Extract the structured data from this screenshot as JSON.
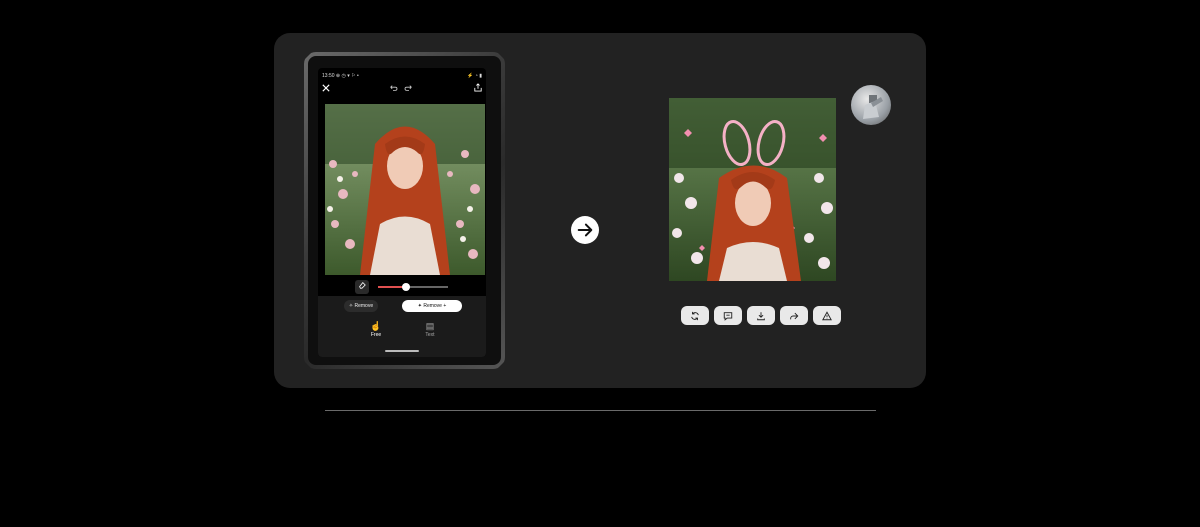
{
  "tablet": {
    "status_time": "13:50",
    "status_icons": "⊕ ◷ ▾ ⚐ •",
    "status_right": "⚡ ◔ ▮",
    "toolbar": {
      "close_icon": "close-icon",
      "undo_icon": "undo-icon",
      "redo_icon": "redo-icon",
      "share_icon": "share-icon"
    },
    "brush_size": 0.4,
    "buttons": {
      "remove_label": "Remove",
      "remove_plus_label": "Remove +"
    },
    "modes": [
      {
        "label": "Free",
        "icon": "hand-pointer-icon"
      },
      {
        "label": "Text",
        "icon": "text-doc-icon"
      }
    ]
  },
  "arrow_icon": "arrow-right-icon",
  "result": {
    "actions": [
      {
        "name": "regenerate",
        "icon": "refresh-icon"
      },
      {
        "name": "feedback",
        "icon": "chat-icon"
      },
      {
        "name": "download",
        "icon": "download-icon"
      },
      {
        "name": "share",
        "icon": "forward-icon"
      },
      {
        "name": "report",
        "icon": "warning-icon"
      }
    ]
  },
  "colors": {
    "card": "#222222",
    "accent": "#e05050",
    "button_light": "#e9e9e9"
  }
}
